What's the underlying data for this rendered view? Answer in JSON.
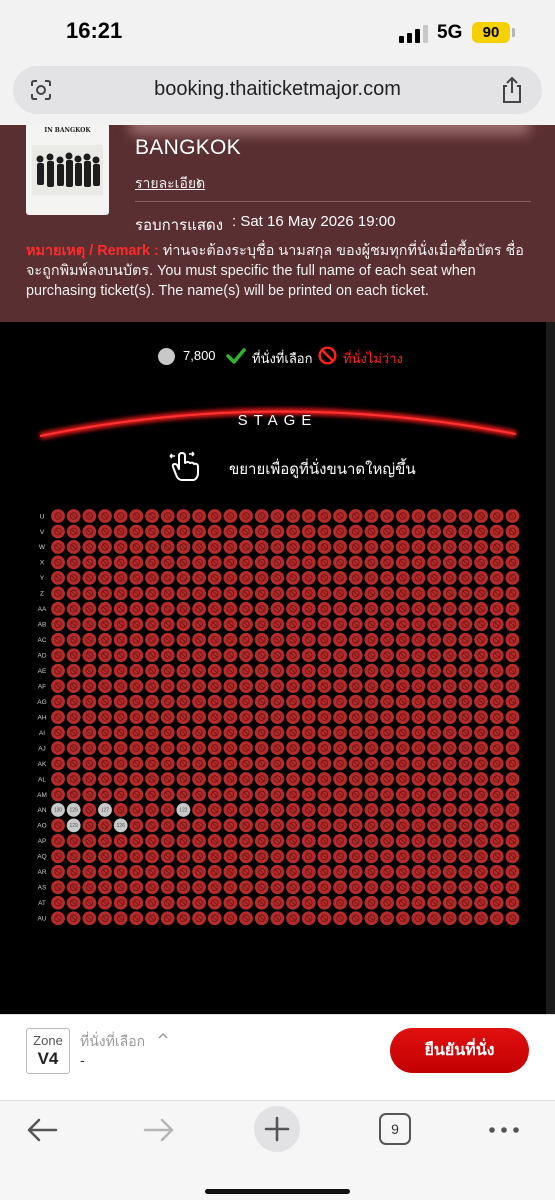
{
  "status_bar": {
    "time": "16:21",
    "network": "5G",
    "battery": "90"
  },
  "browser": {
    "url": "booking.thaiticketmajor.com"
  },
  "event": {
    "title_line": "BANGKOK",
    "poster_title": "IN BANGKOK",
    "details_link": "รายละเอียด",
    "showtime_label": "รอบการแสดง",
    "showtime_value": ": Sat 16 May 2026 19:00",
    "remark_label": "หมายเหตุ / Remark :",
    "remark_text": "ท่านจะต้องระบุชื่อ นามสกุล ของผู้ชมทุกที่นั่งเมื่อซื้อบัตร ชื่อจะถูกพิมพ์ลงบนบัตร. You must specific the full name of each seat when purchasing ticket(s). The name(s) will be printed on each ticket."
  },
  "legend": {
    "price": "7,800",
    "selected": "ที่นั่งที่เลือก",
    "unavailable": "ที่นั่งไม่ว่าง"
  },
  "stage": {
    "label": "STAGE",
    "zoom_hint": "ขยายเพื่อดูที่นั่งขนาดใหญ่ขึ้น"
  },
  "seat_map": {
    "rows": [
      "U",
      "V",
      "W",
      "X",
      "Y",
      "Z",
      "AA",
      "AB",
      "AC",
      "AD",
      "AE",
      "AF",
      "AG",
      "AH",
      "AI",
      "AJ",
      "AK",
      "AL",
      "AM",
      "AN",
      "AO",
      "AP",
      "AQ",
      "AR",
      "AS",
      "AT",
      "AU"
    ],
    "seats_per_row": 30,
    "available": [
      {
        "row": "AN",
        "seat_index": 0,
        "label": "130"
      },
      {
        "row": "AN",
        "seat_index": 1,
        "label": "129"
      },
      {
        "row": "AN",
        "seat_index": 3,
        "label": "127"
      },
      {
        "row": "AN",
        "seat_index": 8,
        "label": "122"
      },
      {
        "row": "AO",
        "seat_index": 1,
        "label": "129"
      },
      {
        "row": "AO",
        "seat_index": 4,
        "label": "126"
      }
    ],
    "colors": {
      "unavailable": "#b52c2c",
      "available": "#c9c9c9",
      "block": "#7a1515"
    }
  },
  "booking": {
    "zone_label": "Zone",
    "zone_value": "V4",
    "selected_label": "ที่นั่งที่เลือก",
    "selected_value": "-",
    "confirm_label": "ยืนยันที่นั่ง"
  },
  "toolbar": {
    "tab_count": "9"
  }
}
